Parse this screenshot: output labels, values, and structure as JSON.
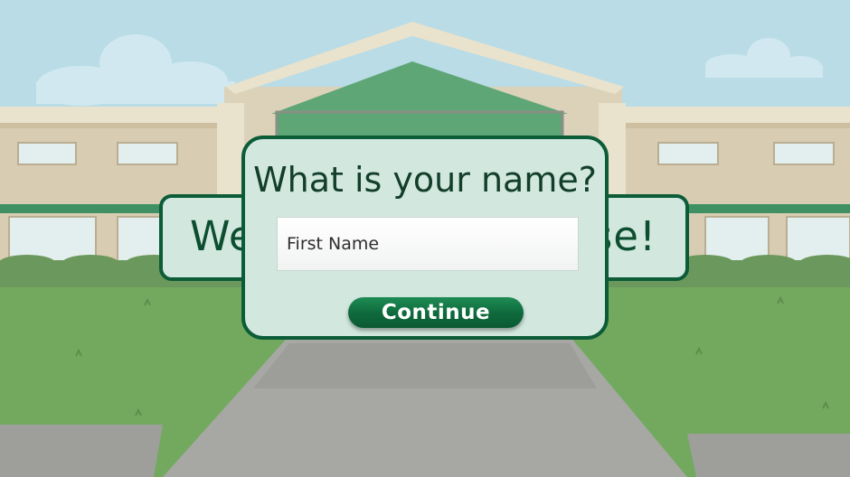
{
  "background": {
    "name": "school-building",
    "colors": {
      "sky": "#b9dce6",
      "grass": "#72a95f",
      "path": "#a7a7a4",
      "roof": "#5ea676",
      "dialog_fill": "#d2e8df",
      "dialog_border": "#0b5c37"
    }
  },
  "welcome_panel": {
    "left_fragment": "We",
    "right_fragment": "se!"
  },
  "dialog": {
    "title": "What is your name?",
    "input": {
      "placeholder": "First Name",
      "value": ""
    },
    "continue_label": "Continue"
  }
}
